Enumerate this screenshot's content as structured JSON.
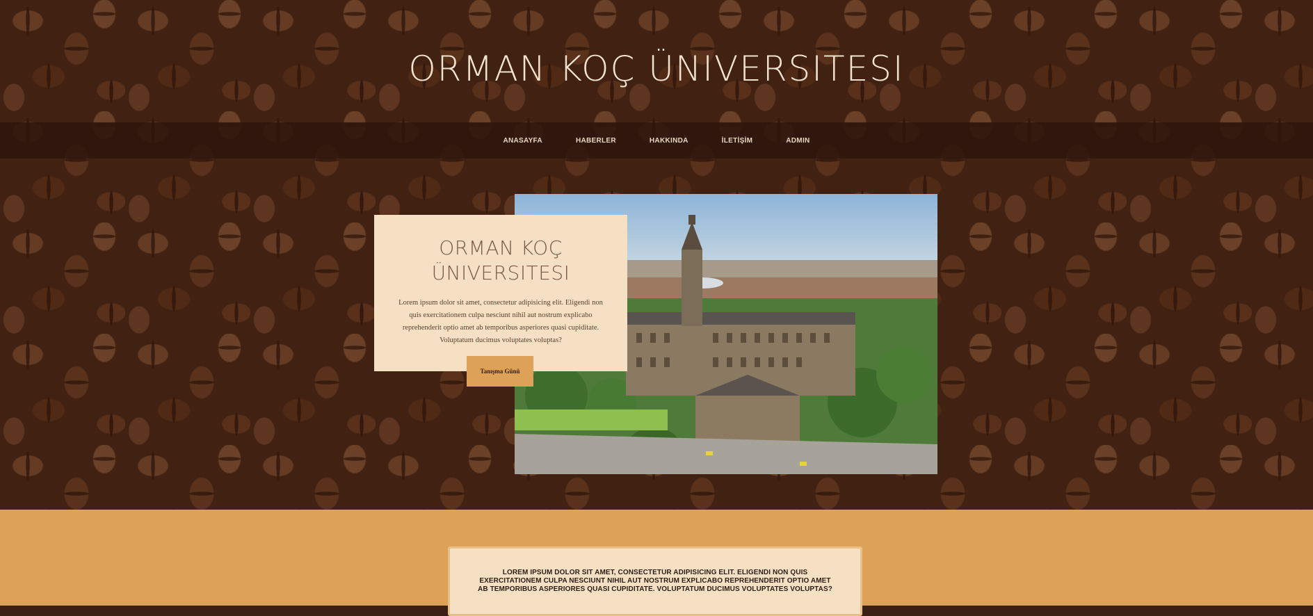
{
  "site": {
    "title": "ORMAN KOÇ ÜNIVERSITESI"
  },
  "nav": {
    "items": [
      "ANASAYFA",
      "HABERLER",
      "HAKKINDA",
      "İLETİŞİM",
      "ADMIN"
    ]
  },
  "intro": {
    "title_line1": "ORMAN KOÇ",
    "title_line2": "ÜNIVERSITESI",
    "text": "Lorem ipsum dolor sit amet, consectetur adipisicing elit. Eligendi non quis exercitationem culpa nesciunt nihil aut nostrum explicabo reprehenderit optio amet ab temporibus asperiores quasi cupiditate. Voluptatum ducimus voluptates voluptas?",
    "button_label": "Tanışma Günü"
  },
  "lower": {
    "text": "LOREM IPSUM DOLOR SIT AMET, CONSECTETUR ADIPISICING ELIT. ELIGENDI NON QUIS EXERCITATIONEM CULPA NESCIUNT NIHIL AUT NOSTRUM EXPLICABO REPREHENDERIT OPTIO AMET AB TEMPORIBUS ASPERIORES QUASI CUPIDITATE. VOLUPTATUM DUCIMUS VOLUPTATES VOLUPTAS?"
  },
  "colors": {
    "accent": "#dda158",
    "card": "#f6e0c3",
    "nav_bg": "#2d160c"
  }
}
